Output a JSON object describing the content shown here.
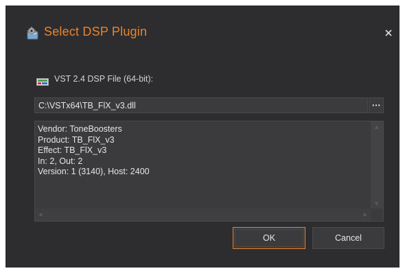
{
  "dialog": {
    "title": "Select DSP Plugin",
    "title_color": "#e8842c",
    "icon": "gear-plugin-icon",
    "close_icon": "close-icon"
  },
  "file": {
    "label": "VST 2.4 DSP File (64-bit):",
    "label_icon": "vst-icon",
    "path_value": "C:\\VSTx64\\TB_FlX_v3.dll",
    "browse_label": "···"
  },
  "info": {
    "lines": [
      "Vendor: ToneBoosters",
      "Product: TB_FlX_v3",
      "Effect: TB_FlX_v3",
      "In: 2, Out: 2",
      "Version: 1 (3140), Host: 2400"
    ]
  },
  "buttons": {
    "ok_label": "OK",
    "cancel_label": "Cancel",
    "accent_color": "#e8842c"
  }
}
